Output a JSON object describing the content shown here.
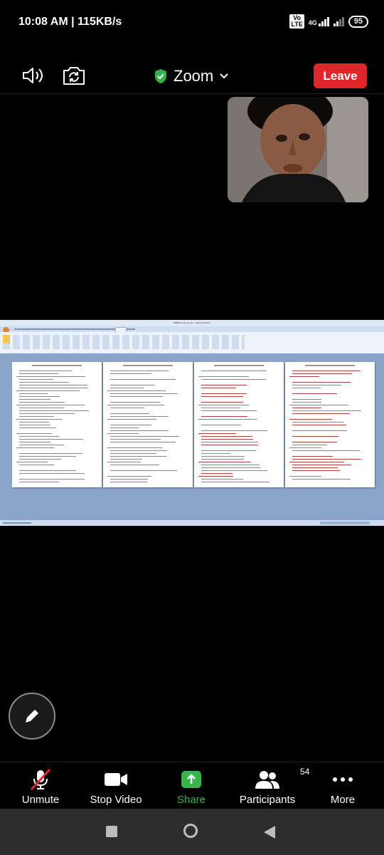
{
  "status_bar": {
    "time_speed": "10:08 AM | 115KB/s",
    "volte": "Vo\nLTE",
    "network": "4G",
    "battery": "95"
  },
  "header": {
    "meeting_title": "Zoom",
    "leave_label": "Leave",
    "secure_color": "#2fb34a"
  },
  "shared_screen": {
    "app_title": "MBBS-S1 (3) (1) 3pl — Microsoft Word",
    "page_headers": [
      "Biology unit 1 (MCQ) A.Y. 2020-21",
      "Biology unit 1 (MCQ) A.Y. 2020-21",
      "Biology unit 1 (MCQ) A.Y. 2020-21",
      "Biology unit 1 (MCQ) A.Y. 2020-21"
    ]
  },
  "toolbar": {
    "unmute_label": "Unmute",
    "stop_video_label": "Stop Video",
    "share_label": "Share",
    "participants_label": "Participants",
    "participants_count": "54",
    "more_label": "More",
    "share_color": "#39b54a"
  },
  "nav_bar": {
    "back": "back-icon",
    "home": "home-icon",
    "recents": "recents-icon"
  }
}
